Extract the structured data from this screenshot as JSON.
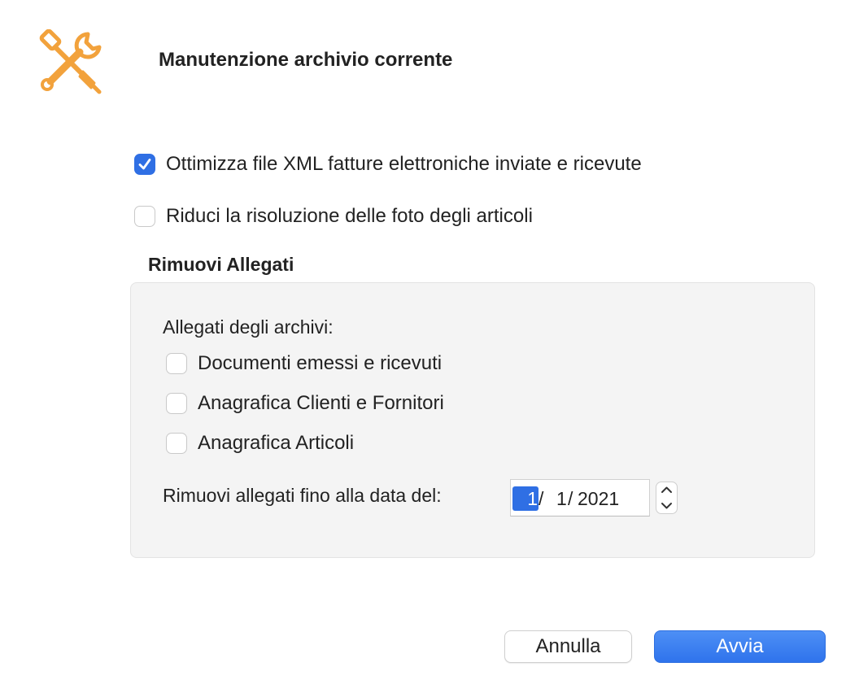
{
  "dialog": {
    "title": "Manutenzione archivio corrente",
    "icon": "wrench-screwdriver-icon",
    "icon_color": "#f2a23c"
  },
  "options": [
    {
      "label": "Ottimizza file XML fatture elettroniche inviate e ricevute",
      "checked": true
    },
    {
      "label": "Riduci la risoluzione delle foto degli articoli",
      "checked": false
    }
  ],
  "attachments": {
    "section_title": "Rimuovi Allegati",
    "group_label": "Allegati degli archivi:",
    "items": [
      {
        "label": "Documenti emessi e ricevuti",
        "checked": false
      },
      {
        "label": "Anagrafica Clienti e Fornitori",
        "checked": false
      },
      {
        "label": "Anagrafica Articoli",
        "checked": false
      }
    ],
    "date_label": "Rimuovi allegati fino alla data del:",
    "date": {
      "day": "1",
      "month": "1",
      "year": "2021",
      "separator": "/"
    }
  },
  "buttons": {
    "cancel": "Annulla",
    "primary": "Avvia"
  },
  "colors": {
    "accent": "#2f6fe4",
    "primary_button": "#3b7ff0"
  }
}
